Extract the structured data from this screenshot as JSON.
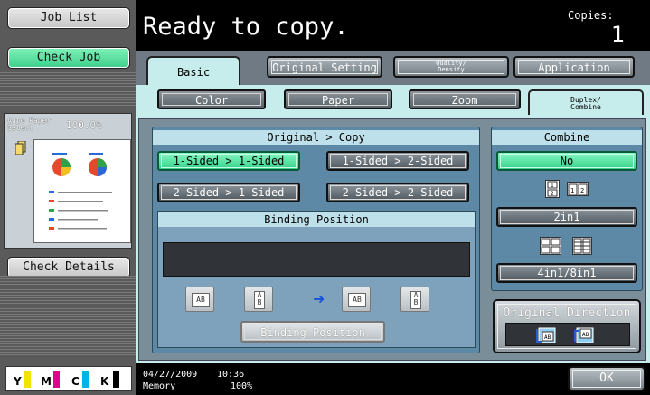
{
  "left_panel": {
    "job_list_label": "Job List",
    "check_job_label": "Check Job",
    "auto_paper_select": "Auto Paper Select",
    "paper_percent": "100.0%",
    "check_details_label": "Check Details",
    "toner": [
      {
        "label": "Y",
        "color": "#f2e400"
      },
      {
        "label": "M",
        "color": "#e0008a"
      },
      {
        "label": "C",
        "color": "#00b4e6"
      },
      {
        "label": "K",
        "color": "#000000"
      }
    ]
  },
  "header": {
    "status": "Ready to copy.",
    "copies_label": "Copies:",
    "copies_value": "1"
  },
  "tabs": {
    "basic": "Basic",
    "original_setting": "Original Setting",
    "quality_density": "Quality/ Density",
    "application": "Application"
  },
  "subtabs": {
    "color": "Color",
    "paper": "Paper",
    "zoom": "Zoom",
    "duplex_combine": "Duplex/ Combine"
  },
  "duplex": {
    "title": "Original > Copy",
    "opt_1_1": "1-Sided > 1-Sided",
    "opt_1_2": "1-Sided > 2-Sided",
    "opt_2_1": "2-Sided > 1-Sided",
    "opt_2_2": "2-Sided > 2-Sided",
    "binding_title": "Binding Position",
    "binding_button": "Binding Position"
  },
  "combine": {
    "title": "Combine",
    "no": "No",
    "two_in_one": "2in1",
    "four_eight": "4in1/8in1"
  },
  "original_direction": {
    "label": "Original Direction"
  },
  "footer": {
    "date": "04/27/2009",
    "time": "10:36",
    "memory_label": "Memory",
    "memory_value": "100%",
    "ok_label": "OK"
  }
}
